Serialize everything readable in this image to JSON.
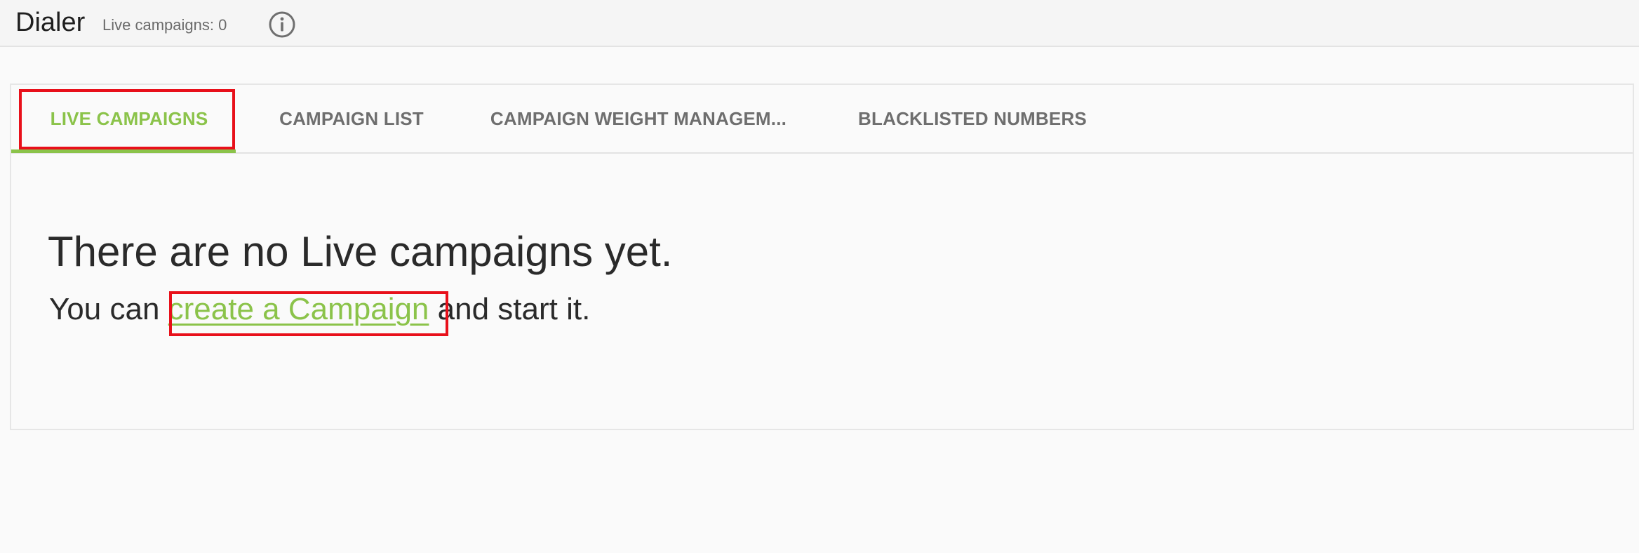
{
  "header": {
    "title": "Dialer",
    "live_campaigns_label": "Live campaigns: 0",
    "info_icon": "info-circle-icon"
  },
  "tabs": [
    {
      "label": "LIVE CAMPAIGNS",
      "active": true
    },
    {
      "label": "CAMPAIGN LIST",
      "active": false
    },
    {
      "label": "CAMPAIGN WEIGHT MANAGEM...",
      "active": false
    },
    {
      "label": "BLACKLISTED NUMBERS",
      "active": false
    }
  ],
  "empty_state": {
    "heading": "There are no Live campaigns yet.",
    "prefix": "You can ",
    "link_text": "create a Campaign",
    "suffix": " and start it."
  },
  "colors": {
    "accent": "#8bc34a",
    "highlight": "#e8101a",
    "tab_text": "#6e6e6e"
  }
}
